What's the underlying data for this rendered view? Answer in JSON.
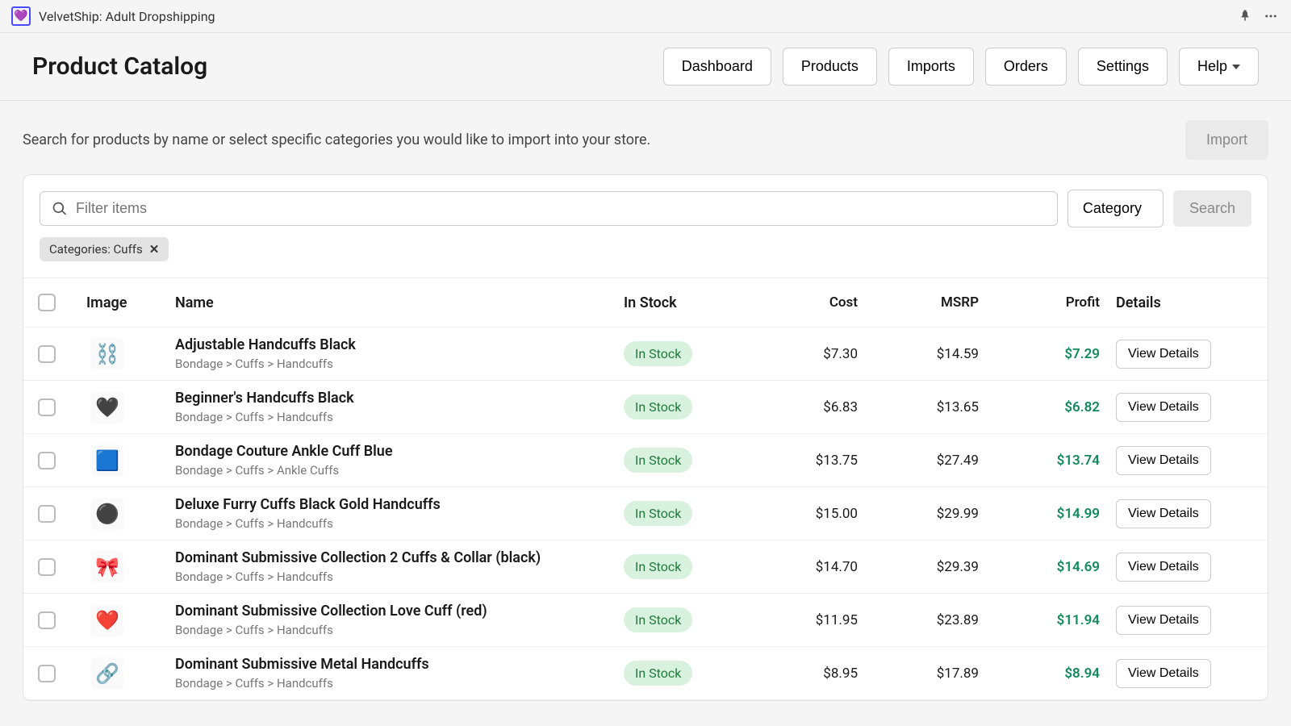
{
  "topbar": {
    "app_title": "VelvetShip: Adult Dropshipping"
  },
  "header": {
    "page_title": "Product Catalog",
    "nav": {
      "dashboard": "Dashboard",
      "products": "Products",
      "imports": "Imports",
      "orders": "Orders",
      "settings": "Settings",
      "help": "Help"
    }
  },
  "subhead": {
    "help_text": "Search for products by name or select specific categories you would like to import into your store.",
    "import_btn": "Import"
  },
  "filter": {
    "search_placeholder": "Filter items",
    "category_btn": "Category",
    "search_btn": "Search",
    "chip_label": "Categories: Cuffs"
  },
  "table": {
    "headers": {
      "image": "Image",
      "name": "Name",
      "instock": "In Stock",
      "cost": "Cost",
      "msrp": "MSRP",
      "profit": "Profit",
      "details": "Details"
    },
    "view_details": "View Details",
    "rows": [
      {
        "name": "Adjustable Handcuffs Black",
        "crumbs": "Bondage > Cuffs > Handcuffs",
        "stock": "In Stock",
        "cost": "$7.30",
        "msrp": "$14.59",
        "profit": "$7.29",
        "icon": "⛓️"
      },
      {
        "name": "Beginner's Handcuffs Black",
        "crumbs": "Bondage > Cuffs > Handcuffs",
        "stock": "In Stock",
        "cost": "$6.83",
        "msrp": "$13.65",
        "profit": "$6.82",
        "icon": "🖤"
      },
      {
        "name": "Bondage Couture Ankle Cuff Blue",
        "crumbs": "Bondage > Cuffs > Ankle Cuffs",
        "stock": "In Stock",
        "cost": "$13.75",
        "msrp": "$27.49",
        "profit": "$13.74",
        "icon": "🟦"
      },
      {
        "name": "Deluxe Furry Cuffs Black Gold Handcuffs",
        "crumbs": "Bondage > Cuffs > Handcuffs",
        "stock": "In Stock",
        "cost": "$15.00",
        "msrp": "$29.99",
        "profit": "$14.99",
        "icon": "⚫"
      },
      {
        "name": "Dominant Submissive Collection 2 Cuffs & Collar (black)",
        "crumbs": "Bondage > Cuffs > Handcuffs",
        "stock": "In Stock",
        "cost": "$14.70",
        "msrp": "$29.39",
        "profit": "$14.69",
        "icon": "🎀"
      },
      {
        "name": "Dominant Submissive Collection Love Cuff (red)",
        "crumbs": "Bondage > Cuffs > Handcuffs",
        "stock": "In Stock",
        "cost": "$11.95",
        "msrp": "$23.89",
        "profit": "$11.94",
        "icon": "❤️"
      },
      {
        "name": "Dominant Submissive Metal Handcuffs",
        "crumbs": "Bondage > Cuffs > Handcuffs",
        "stock": "In Stock",
        "cost": "$8.95",
        "msrp": "$17.89",
        "profit": "$8.94",
        "icon": "🔗"
      }
    ]
  }
}
